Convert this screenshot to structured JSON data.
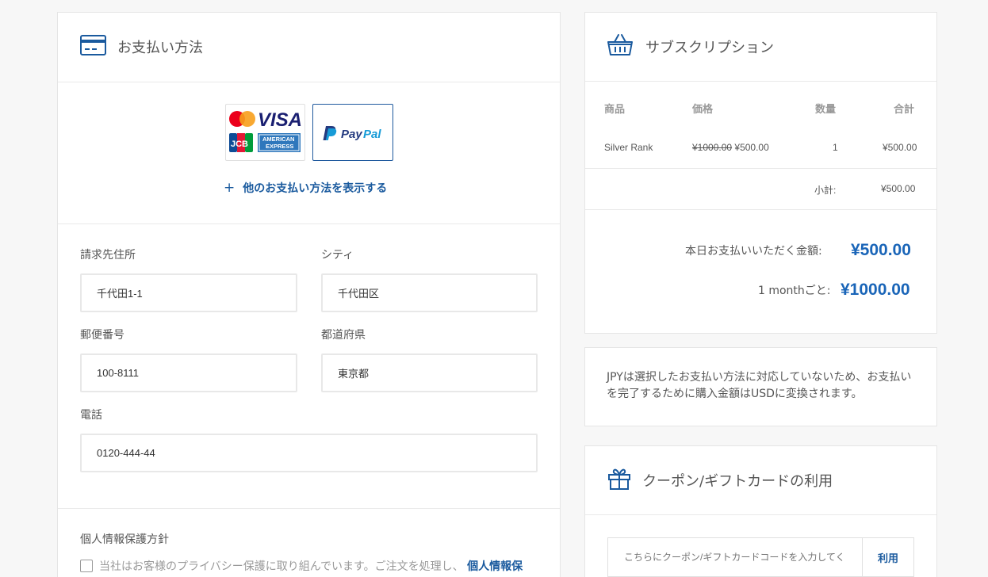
{
  "payment": {
    "title": "お支払い方法",
    "show_more": "他のお支払い方法を表示する",
    "card_brands": [
      "VISA",
      "JCB",
      "AMERICAN EXPRESS"
    ],
    "paypal_label": "PayPal"
  },
  "address": {
    "billing_label": "請求先住所",
    "billing_value": "千代田1-1",
    "city_label": "シティ",
    "city_value": "千代田区",
    "postal_label": "郵便番号",
    "postal_value": "100-8111",
    "prefecture_label": "都道府県",
    "prefecture_value": "東京都",
    "phone_label": "電話",
    "phone_value": "0120-444-44"
  },
  "privacy": {
    "title": "個人情報保護方針",
    "text": "当社はお客様のプライバシー保護に取り組んでいます。ご注文を処理し、",
    "link": "個人情報保"
  },
  "subscription": {
    "title": "サブスクリプション",
    "headers": [
      "商品",
      "価格",
      "数量",
      "合計"
    ],
    "row": {
      "product": "Silver Rank",
      "original_price": "¥1000.00",
      "price": "¥500.00",
      "quantity": "1",
      "total": "¥500.00"
    },
    "subtotal_label": "小計:",
    "subtotal_value": "¥500.00",
    "due_today_label": "本日お支払いいただく金額:",
    "due_today_value": "¥500.00",
    "recurring_label": "1 monthごと:",
    "recurring_value": "¥1000.00"
  },
  "notice": {
    "text": "JPYは選択したお支払い方法に対応していないため、お支払いを完了するために購入金額はUSDに変換されます。"
  },
  "coupon": {
    "title": "クーポン/ギフトカードの利用",
    "placeholder": "こちらにクーポン/ギフトカードコードを入力してく",
    "apply_label": "利用"
  },
  "colors": {
    "accent": "#1a5a9e",
    "price_blue": "#1a65b8",
    "mastercard_red": "#eb001b",
    "mastercard_orange": "#f79e1b",
    "visa_blue": "#1a1f71",
    "amex_blue": "#2e77bc",
    "paypal_dark": "#253b80",
    "paypal_light": "#179bd7"
  }
}
